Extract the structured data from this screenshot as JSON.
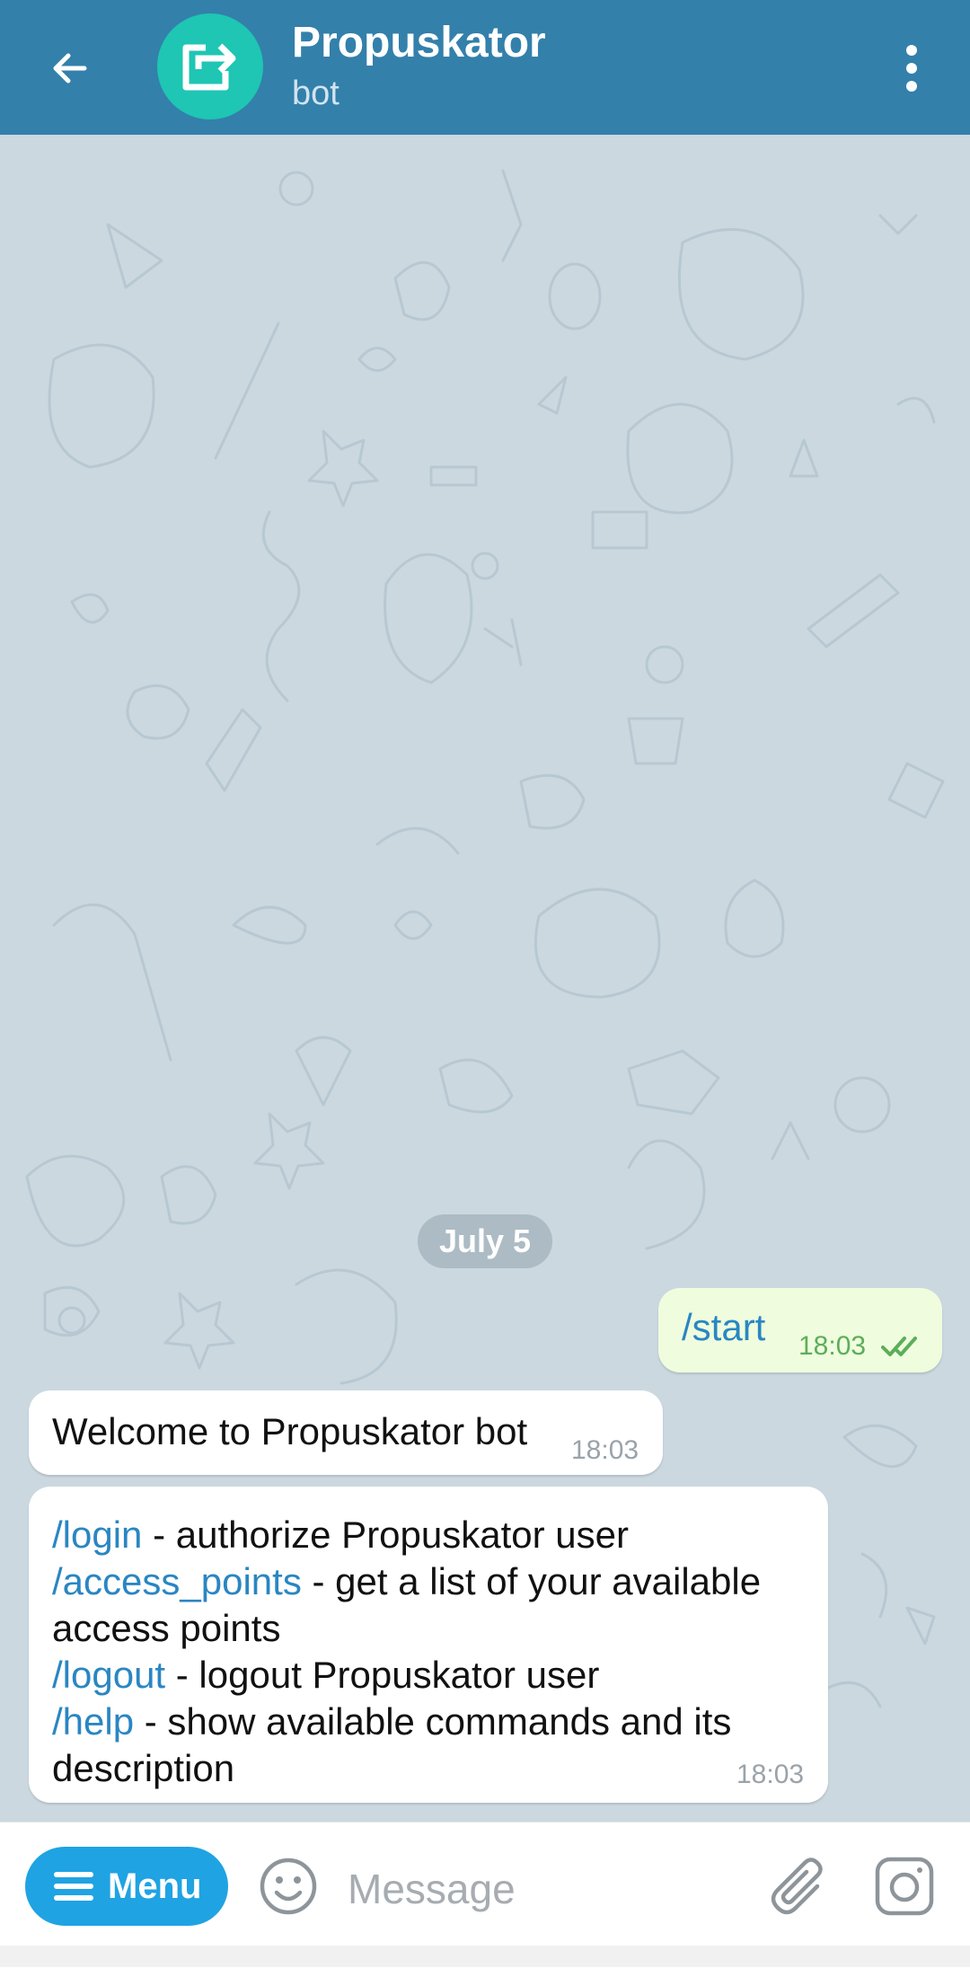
{
  "header": {
    "title": "Propuskator",
    "subtitle": "bot",
    "back_icon": "arrow-left-icon",
    "avatar_icon": "share-forward-icon",
    "menu_icon": "more-vertical-icon",
    "color": "#3380ab",
    "avatar_color": "#1ec6b3"
  },
  "chat": {
    "date": "July 5",
    "messages": [
      {
        "direction": "outgoing",
        "text": "/start",
        "time": "18:03",
        "status_icon": "double-check-icon"
      },
      {
        "direction": "incoming",
        "text": "Welcome to Propuskator bot",
        "time": "18:03"
      },
      {
        "direction": "incoming",
        "time": "18:03",
        "lines": [
          {
            "command": "/login",
            "description": " - authorize Propuskator user"
          },
          {
            "command": "/access_points",
            "description": " - get a list of your available"
          },
          {
            "command": "",
            "description": "access points"
          },
          {
            "command": "/logout",
            "description": " - logout Propuskator user"
          },
          {
            "command": "/help",
            "description": " - show available commands and its"
          },
          {
            "command": "",
            "description": "description"
          }
        ]
      }
    ]
  },
  "input_bar": {
    "menu_label": "Menu",
    "placeholder": "Message",
    "icons": [
      "hamburger-icon",
      "emoji-icon",
      "paperclip-icon",
      "camera-icon"
    ],
    "accent_color": "#1fa3e3"
  }
}
